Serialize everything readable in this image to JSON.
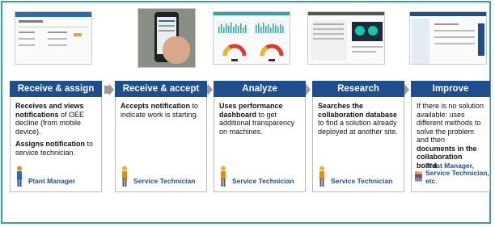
{
  "steps": [
    {
      "title": "Receive & assign",
      "paragraphs": [
        [
          {
            "t": "Receives and views notifications",
            "b": true
          },
          {
            "t": " of OEE decline (from mobile device).",
            "b": false
          }
        ],
        [
          {
            "t": "Assigns notification",
            "b": true
          },
          {
            "t": " to service technician.",
            "b": false
          }
        ]
      ],
      "role": "Plant Manager"
    },
    {
      "title": "Receive & accept",
      "paragraphs": [
        [
          {
            "t": "Accepts notification",
            "b": true
          },
          {
            "t": " to indicate work is starting.",
            "b": false
          }
        ]
      ],
      "role": "Service Technician"
    },
    {
      "title": "Analyze",
      "paragraphs": [
        [
          {
            "t": "Uses performance dashboard",
            "b": true
          },
          {
            "t": " to get additional transparency on machines.",
            "b": false
          }
        ]
      ],
      "role": "Service Technician"
    },
    {
      "title": "Research",
      "paragraphs": [
        [
          {
            "t": "Searches the collaboration database",
            "b": true
          },
          {
            "t": " to find a solution already deployed at another site.",
            "b": false
          }
        ]
      ],
      "role": "Service Technician"
    },
    {
      "title": "Improve",
      "paragraphs": [
        [
          {
            "t": "If there is no solution available: uses different methods to solve the problem and then ",
            "b": false
          },
          {
            "t": "documents in the collaboration board",
            "b": true
          },
          {
            "t": ".",
            "b": false
          }
        ]
      ],
      "role": "Plant Manager, Service Technician, etc."
    }
  ],
  "thumbnails": [
    "web-app-screenshot",
    "mobile-phone-photo",
    "performance-dashboard-screenshot",
    "collaboration-database-screenshot",
    "collaboration-board-screenshot"
  ],
  "colors": {
    "accent": "#2aa99a",
    "header": "#1f4e8c",
    "arrow": "#9a9a9a",
    "role_text": "#1f4e8c",
    "figure_orange": "#e58a1f"
  }
}
